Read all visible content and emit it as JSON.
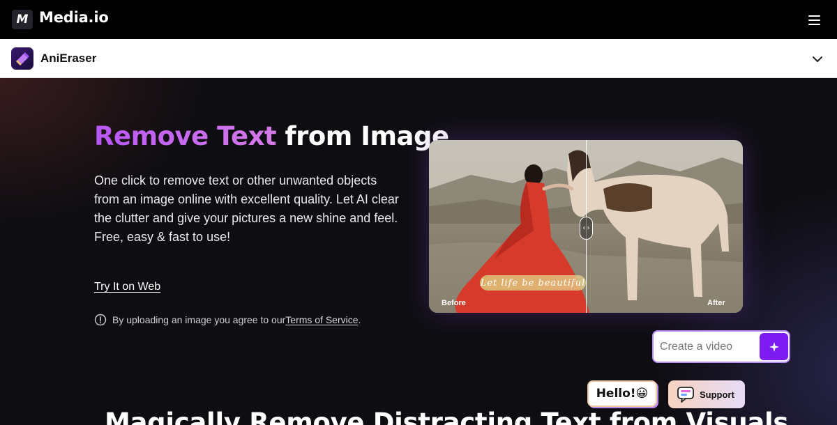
{
  "header": {
    "logo_mark": "M",
    "brand": "Media.io",
    "menu_icon": "hamburger-menu-icon"
  },
  "product_bar": {
    "name": "AniEraser",
    "logo_icon": "anieraser-logo-icon",
    "expand_icon": "chevron-down-icon"
  },
  "hero": {
    "title_accent": "Remove Text",
    "title_rest": "from Image",
    "description": "One click to remove text or other unwanted objects from an image online with excellent quality. Let AI clear the clutter and give your pictures a new shine and feel. Free, easy & fast to use!",
    "cta_link": "Try It on Web",
    "notice_prefix": "By uploading an image you agree to our ",
    "notice_link": "Terms of Service",
    "notice_suffix": "."
  },
  "compare_image": {
    "before_label": "Before",
    "after_label": "After",
    "overlay_text": "Let life be beautiful",
    "handle_icon": "‹›",
    "slider_position": 0.5
  },
  "create_video": {
    "placeholder": "Create a video",
    "submit_icon": "sparkle-icon"
  },
  "chat": {
    "hello": "Hello!😀",
    "support": "Support"
  },
  "section": {
    "heading": "Magically Remove Distracting Text from Visuals"
  },
  "colors": {
    "accent_purple": "#b957f7",
    "button_purple": "#7c1cf3",
    "hero_bg": "#0e0d11"
  }
}
